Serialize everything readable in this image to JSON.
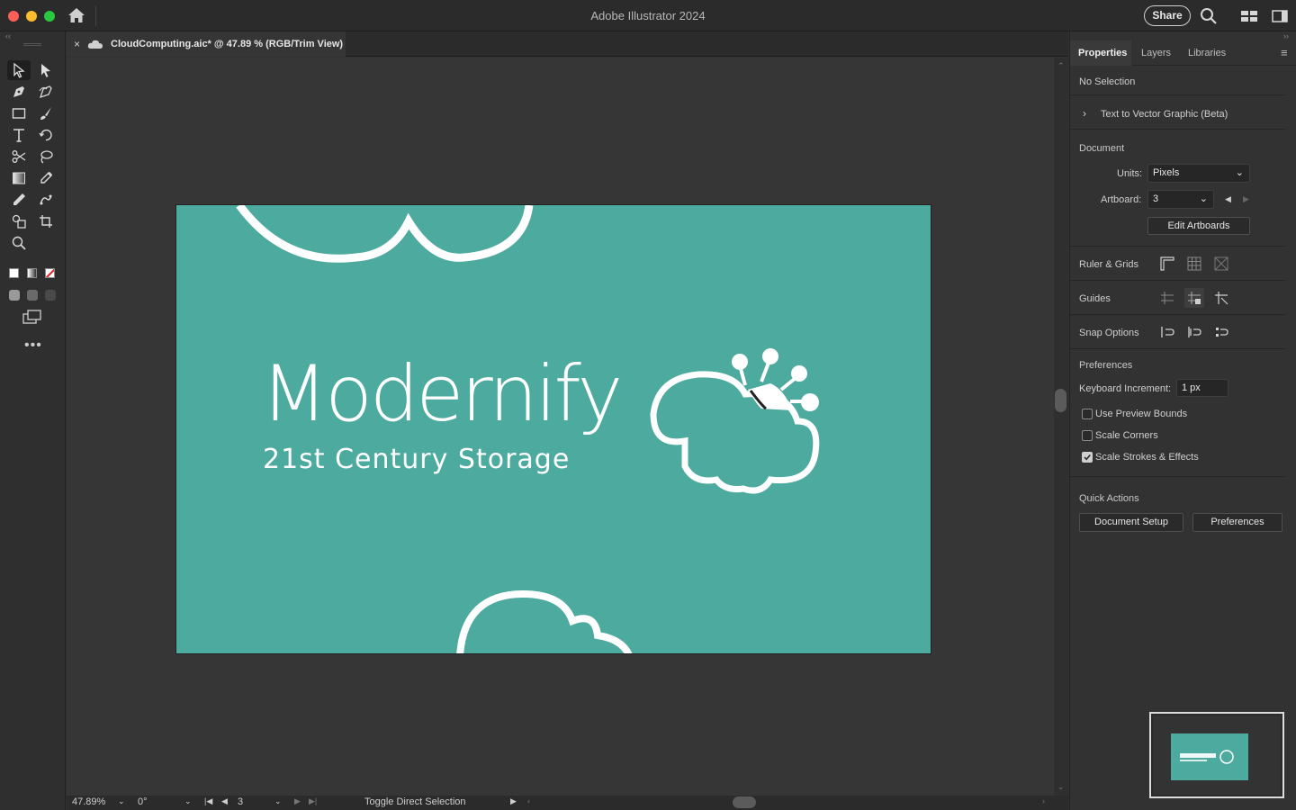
{
  "window": {
    "app_title": "Adobe Illustrator 2024",
    "share_label": "Share"
  },
  "document_tab": {
    "close_glyph": "×",
    "label": "CloudComputing.aic* @ 47.89 % (RGB/Trim View)"
  },
  "artboard": {
    "background_color": "#4daa9e",
    "logo_title": "Modernify",
    "logo_subtitle": "21st Century Storage"
  },
  "status_bar": {
    "zoom_value": "47.89%",
    "rotation_value": "0°",
    "artboard_number": "3",
    "tool_hint": "Toggle Direct Selection"
  },
  "properties_panel": {
    "tabs": [
      {
        "label": "Properties",
        "active": true
      },
      {
        "label": "Layers",
        "active": false
      },
      {
        "label": "Libraries",
        "active": false
      }
    ],
    "selection_state": "No Selection",
    "text_to_vector": "Text to Vector Graphic (Beta)",
    "document_heading": "Document",
    "units_label": "Units:",
    "units_value": "Pixels",
    "artboard_label": "Artboard:",
    "artboard_value": "3",
    "edit_artboards_label": "Edit Artboards",
    "ruler_grids_label": "Ruler & Grids",
    "guides_label": "Guides",
    "snap_options_label": "Snap Options",
    "preferences_heading": "Preferences",
    "keyboard_increment_label": "Keyboard Increment:",
    "keyboard_increment_value": "1 px",
    "checkboxes": [
      {
        "label": "Use Preview Bounds",
        "checked": false
      },
      {
        "label": "Scale Corners",
        "checked": false
      },
      {
        "label": "Scale Strokes & Effects",
        "checked": true
      }
    ],
    "quick_actions_heading": "Quick Actions",
    "document_setup_label": "Document Setup",
    "preferences_button_label": "Preferences"
  },
  "tools": [
    "selection-tool-icon",
    "direct-selection-tool-icon",
    "pen-tool-icon",
    "curvature-tool-icon",
    "rectangle-tool-icon",
    "paintbrush-tool-icon",
    "type-tool-icon",
    "rotate-tool-icon",
    "scissors-tool-icon",
    "lasso-tool-icon",
    "gradient-tool-icon",
    "eyedropper-tool-icon",
    "eyedropper-tool-icon",
    "puppet-warp-tool-icon",
    "shape-builder-tool-icon",
    "artboard-tool-icon",
    "zoom-tool-icon"
  ],
  "colors": {
    "accent": "#4daa9e",
    "ui_dark": "#2b2b2b"
  }
}
